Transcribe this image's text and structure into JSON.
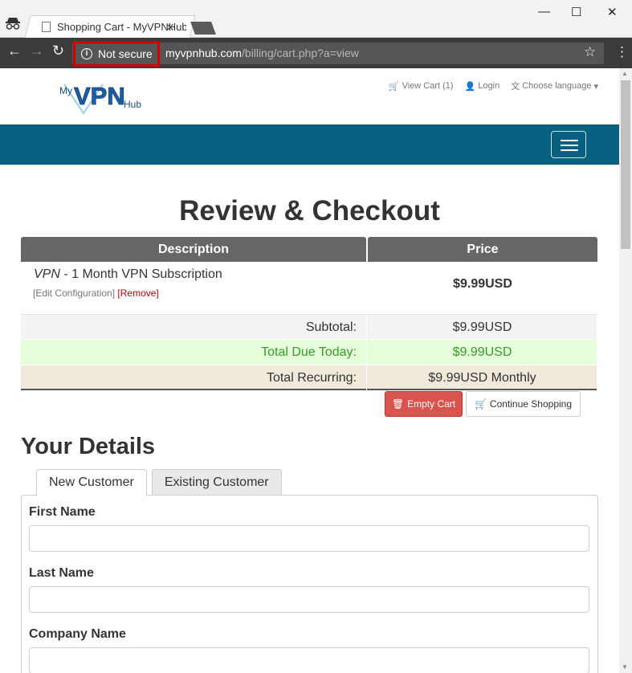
{
  "browser": {
    "tab_title": "Shopping Cart - MyVPNHub",
    "security_label": "Not secure",
    "url_host": "myvpnhub.com",
    "url_path": "/billing/cart.php?a=view"
  },
  "site": {
    "logo_text": "MyVPNHub",
    "top_nav": {
      "view_cart": "View Cart (1)",
      "login": "Login",
      "language": "Choose language"
    },
    "brand_color": "#05617f"
  },
  "cart": {
    "heading": "Review & Checkout",
    "columns": {
      "description": "Description",
      "price": "Price"
    },
    "item": {
      "product_group": "VPN",
      "product_name": " - 1 Month VPN Subscription",
      "edit_link": "[Edit Configuration]",
      "remove_link": "[Remove]",
      "price": "$9.99USD"
    },
    "subtotal": {
      "label": "Subtotal:",
      "value": "$9.99USD"
    },
    "total_due": {
      "label": "Total Due Today:",
      "value": "$9.99USD"
    },
    "recurring": {
      "label": "Total Recurring:",
      "value": "$9.99USD Monthly"
    },
    "buttons": {
      "empty": "Empty Cart",
      "continue": "Continue Shopping"
    }
  },
  "details": {
    "heading": "Your Details",
    "tabs": [
      "New Customer",
      "Existing Customer"
    ],
    "fields": [
      {
        "label": "First Name",
        "value": ""
      },
      {
        "label": "Last Name",
        "value": ""
      },
      {
        "label": "Company Name",
        "value": ""
      }
    ]
  }
}
